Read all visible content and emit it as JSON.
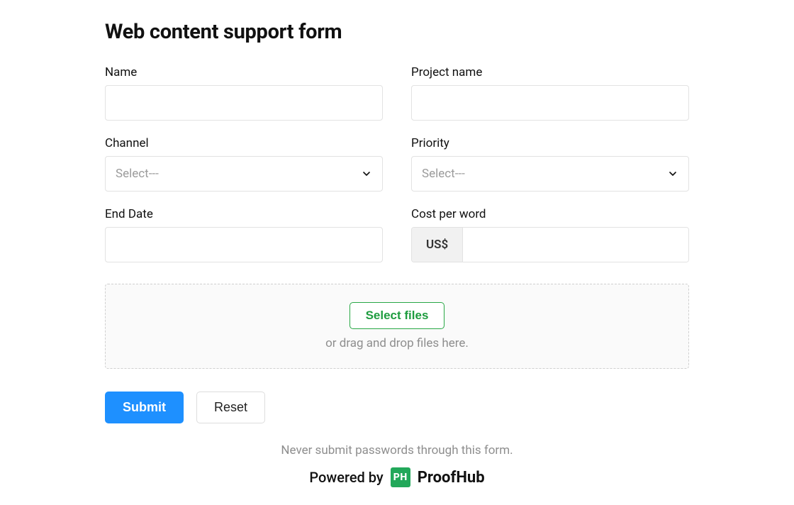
{
  "title": "Web content support form",
  "fields": {
    "name": {
      "label": "Name"
    },
    "project_name": {
      "label": "Project name"
    },
    "channel": {
      "label": "Channel",
      "placeholder": "Select---"
    },
    "priority": {
      "label": "Priority",
      "placeholder": "Select---"
    },
    "end_date": {
      "label": "End Date"
    },
    "cost_per_word": {
      "label": "Cost per word",
      "currency_prefix": "US$"
    }
  },
  "upload": {
    "button": "Select files",
    "hint": "or drag and drop files here."
  },
  "actions": {
    "submit": "Submit",
    "reset": "Reset"
  },
  "footer": {
    "warning": "Never submit passwords through this form.",
    "powered_by": "Powered by",
    "brand_badge": "PH",
    "brand_name": "ProofHub"
  }
}
